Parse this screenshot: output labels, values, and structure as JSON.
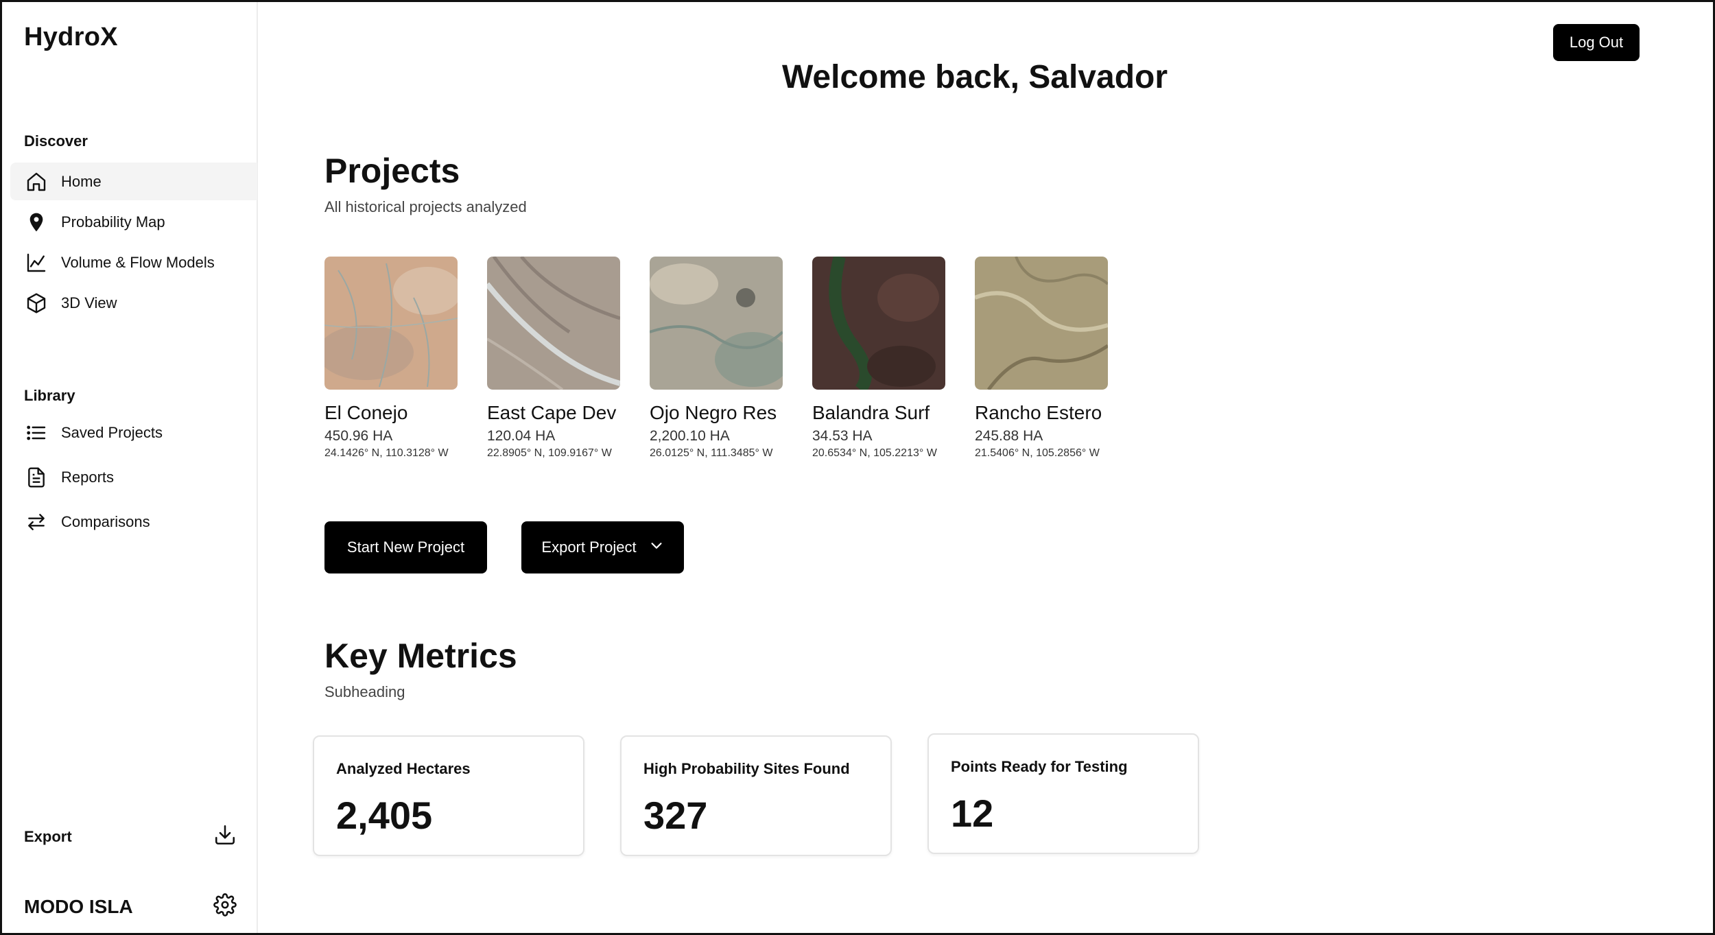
{
  "app": {
    "name": "HydroX"
  },
  "sidebar": {
    "discover_label": "Discover",
    "discover_items": [
      {
        "label": "Home",
        "icon": "home-icon",
        "active": true
      },
      {
        "label": "Probability Map",
        "icon": "map-pin-icon"
      },
      {
        "label": "Volume & Flow Models",
        "icon": "line-chart-icon"
      },
      {
        "label": "3D View",
        "icon": "cube-icon"
      }
    ],
    "library_label": "Library",
    "library_items": [
      {
        "label": "Saved Projects",
        "icon": "list-icon"
      },
      {
        "label": "Reports",
        "icon": "document-icon"
      },
      {
        "label": "Comparisons",
        "icon": "swap-arrows-icon"
      }
    ],
    "export_label": "Export",
    "brand_label": "MODO ISLA"
  },
  "header": {
    "logout_label": "Log Out",
    "welcome": "Welcome back, Salvador"
  },
  "projects": {
    "title": "Projects",
    "subtitle": "All historical projects analyzed",
    "items": [
      {
        "name": "El Conejo",
        "area": "450.96 HA",
        "coords": "24.1426° N, 110.3128° W"
      },
      {
        "name": "East Cape Dev",
        "area": "120.04 HA",
        "coords": "22.8905° N, 109.9167° W"
      },
      {
        "name": "Ojo Negro Res",
        "area": "2,200.10 HA",
        "coords": "26.0125° N, 111.3485° W"
      },
      {
        "name": "Balandra Surf",
        "area": "34.53 HA",
        "coords": "20.6534° N, 105.2213° W"
      },
      {
        "name": "Rancho Estero",
        "area": "245.88 HA",
        "coords": "21.5406° N, 105.2856° W"
      }
    ],
    "start_label": "Start New Project",
    "export_label": "Export Project"
  },
  "metrics": {
    "title": "Key Metrics",
    "subtitle": "Subheading",
    "cards": [
      {
        "title": "Analyzed Hectares",
        "value": "2,405"
      },
      {
        "title": "High Probability Sites Found",
        "value": "327"
      },
      {
        "title": "Points Ready for Testing",
        "value": "12"
      }
    ]
  }
}
